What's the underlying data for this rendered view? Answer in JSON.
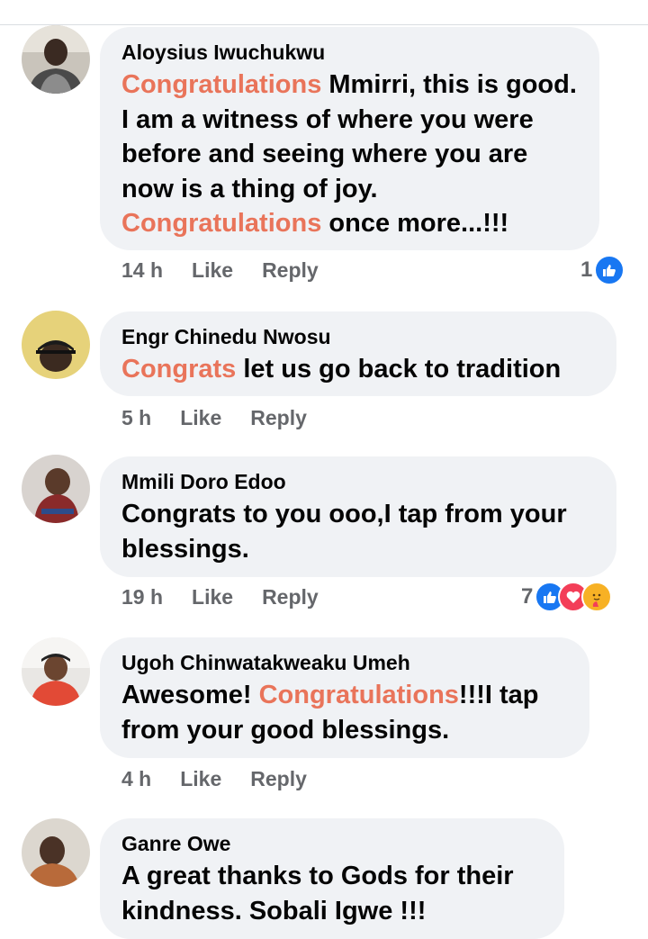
{
  "comments": [
    {
      "author": "Aloysius Iwuchukwu",
      "text_parts": [
        {
          "t": "Congratulations",
          "hl": true
        },
        {
          "t": " Mmirri, this is good. I am a witness of where you were before and seeing where you are now is a thing of joy. ",
          "hl": false
        },
        {
          "t": "Congratulations",
          "hl": true
        },
        {
          "t": " once more...!!!",
          "hl": false
        }
      ],
      "time": "14 h",
      "like_label": "Like",
      "reply_label": "Reply",
      "reaction_count": "1",
      "reactions": [
        "like-icon"
      ]
    },
    {
      "author": "Engr Chinedu Nwosu",
      "text_parts": [
        {
          "t": "Congrats",
          "hl": true
        },
        {
          "t": " let us go back to tradition",
          "hl": false
        }
      ],
      "time": "5 h",
      "like_label": "Like",
      "reply_label": "Reply"
    },
    {
      "author": "Mmili Doro Edoo",
      "text_parts": [
        {
          "t": "Congrats to you ooo,I tap from your blessings.",
          "hl": false
        }
      ],
      "time": "19 h",
      "like_label": "Like",
      "reply_label": "Reply",
      "reaction_count": "7",
      "reactions": [
        "like-icon",
        "love-icon",
        "care-icon"
      ]
    },
    {
      "author": "Ugoh Chinwatakweaku Umeh",
      "text_parts": [
        {
          "t": "Awesome! ",
          "hl": false
        },
        {
          "t": "Congratulations",
          "hl": true
        },
        {
          "t": "!!!I tap from your good blessings.",
          "hl": false
        }
      ],
      "time": "4 h",
      "like_label": "Like",
      "reply_label": "Reply"
    },
    {
      "author": "Ganre Owe",
      "text_parts": [
        {
          "t": "A great thanks to Gods for their kindness. Sobali Igwe !!!",
          "hl": false
        }
      ]
    }
  ],
  "colors": {
    "highlight": "#e9745a",
    "bubble": "#f0f2f5",
    "meta": "#65676b",
    "like_blue": "#1877f2",
    "love_red": "#f33e58"
  }
}
